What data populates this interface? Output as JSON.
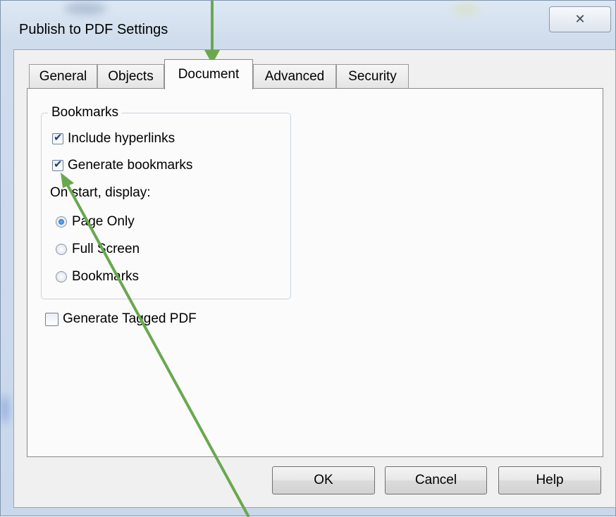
{
  "window": {
    "title": "Publish to PDF Settings",
    "close_glyph": "✕"
  },
  "tabs": [
    {
      "label": "General",
      "active": false
    },
    {
      "label": "Objects",
      "active": false
    },
    {
      "label": "Document",
      "active": true
    },
    {
      "label": "Advanced",
      "active": false
    },
    {
      "label": "Security",
      "active": false
    }
  ],
  "bookmarks": {
    "legend": "Bookmarks",
    "include_hyperlinks": {
      "label": "Include hyperlinks",
      "checked": true
    },
    "generate_bookmarks": {
      "label": "Generate bookmarks",
      "checked": true
    },
    "on_start_label": "On start, display:",
    "options": [
      {
        "label": "Page Only",
        "selected": true
      },
      {
        "label": "Full Screen",
        "selected": false
      },
      {
        "label": "Bookmarks",
        "selected": false
      }
    ]
  },
  "tagged_pdf": {
    "label": "Generate Tagged PDF",
    "checked": false
  },
  "buttons": {
    "ok": "OK",
    "cancel": "Cancel",
    "help": "Help"
  },
  "colors": {
    "annotation_arrow": "#6aa84f",
    "radio_selected": "#0f5fb8",
    "window_frame": "#c8d7ea"
  }
}
